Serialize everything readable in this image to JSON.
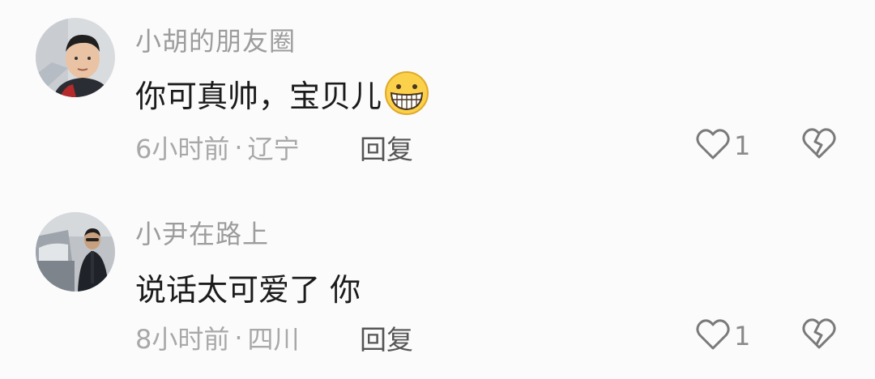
{
  "comments": [
    {
      "username": "小胡的朋友圈",
      "text": "你可真帅，宝贝儿",
      "time": "6小时前",
      "separator": "·",
      "location": "辽宁",
      "reply_label": "回复",
      "like_count": "1",
      "icons": {
        "avatar": "avatar-photo",
        "emoji": "grinning-face-emoji",
        "like": "heart-outline-icon",
        "dislike": "broken-heart-icon"
      }
    },
    {
      "username": "小尹在路上",
      "text": "说话太可爱了 你",
      "time": "8小时前",
      "separator": "·",
      "location": "四川",
      "reply_label": "回复",
      "like_count": "1",
      "icons": {
        "avatar": "avatar-photo",
        "like": "heart-outline-icon",
        "dislike": "broken-heart-icon"
      }
    }
  ],
  "colors": {
    "background": "#fbfbfb",
    "username": "#9c9c9c",
    "content": "#1b1b1b",
    "meta": "#a8a8a8",
    "reply": "#555555",
    "icon": "#7a7a7a"
  }
}
